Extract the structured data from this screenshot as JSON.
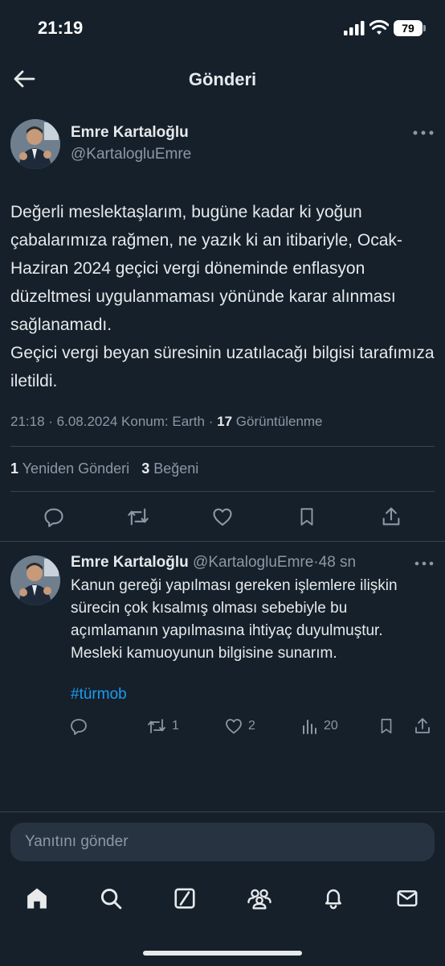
{
  "status_bar": {
    "time": "21:19",
    "battery": "79"
  },
  "header": {
    "title": "Gönderi"
  },
  "post": {
    "author_name": "Emre Kartaloğlu",
    "author_handle": "@KartalogluEmre",
    "text": "Değerli meslektaşlarım, bugüne kadar ki yoğun çabalarımıza rağmen, ne yazık ki an itibariyle, Ocak- Haziran 2024 geçici vergi döneminde enflasyon düzeltmesi uygulanmaması yönünde karar alınması sağlanamadı.\nGeçici vergi beyan süresinin uzatılacağı bilgisi tarafımıza iletildi.",
    "meta": {
      "time": "21:18",
      "date": "6.08.2024",
      "location": "Konum: Earth",
      "views_count": "17",
      "views_label": "Görüntülenme"
    },
    "stats": {
      "reposts_count": "1",
      "reposts_label": "Yeniden Gönderi",
      "likes_count": "3",
      "likes_label": "Beğeni"
    }
  },
  "reply": {
    "author_name": "Emre Kartaloğlu",
    "author_handle": "@KartalogluEmre",
    "time_ago": "48 sn",
    "text": "Kanun gereği yapılması gereken işlemlere ilişkin sürecin çok kısalmış olması sebebiyle bu açımlamanın yapılmasına ihtiyaç duyulmuştur. Mesleki kamuoyunun bilgisine sunarım.",
    "hashtag": "#türmob",
    "actions": {
      "retweets": "1",
      "likes": "2",
      "views": "20"
    }
  },
  "compose": {
    "placeholder": "Yanıtını gönder"
  },
  "bottom_nav": [
    "home-icon",
    "search-icon",
    "grok-icon",
    "communities-icon",
    "notifications-icon",
    "messages-icon"
  ],
  "colors": {
    "background": "#15202b",
    "text": "#e7e9ea",
    "muted": "#8b98a5",
    "link": "#1d9bf0",
    "divider": "#38444d"
  }
}
